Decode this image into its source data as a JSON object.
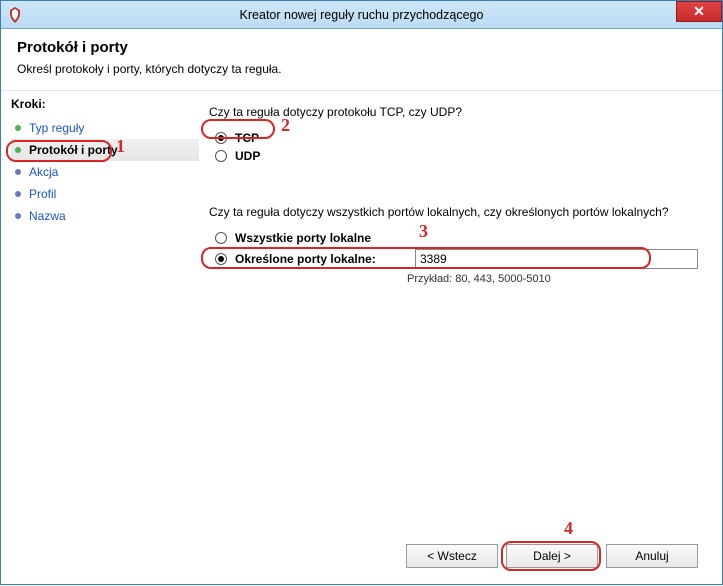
{
  "window": {
    "title": "Kreator nowej reguły ruchu przychodzącego",
    "close_glyph": "✕"
  },
  "header": {
    "title": "Protokół i porty",
    "subtitle": "Określ protokoły i porty, których dotyczy ta reguła."
  },
  "sidebar": {
    "label": "Kroki:",
    "items": [
      {
        "label": "Typ reguły"
      },
      {
        "label": "Protokół i porty"
      },
      {
        "label": "Akcja"
      },
      {
        "label": "Profil"
      },
      {
        "label": "Nazwa"
      }
    ]
  },
  "main": {
    "question_protocol": "Czy ta reguła dotyczy protokołu TCP, czy UDP?",
    "option_tcp": "TCP",
    "option_udp": "UDP",
    "question_ports": "Czy ta reguła dotyczy wszystkich portów lokalnych, czy określonych portów lokalnych?",
    "option_all_ports": "Wszystkie porty lokalne",
    "option_specific_ports": "Określone porty lokalne:",
    "port_value": "3389",
    "hint": "Przykład: 80, 443, 5000-5010"
  },
  "buttons": {
    "back": "< Wstecz",
    "next": "Dalej >",
    "cancel": "Anuluj"
  },
  "annotations": {
    "n1": "1",
    "n2": "2",
    "n3": "3",
    "n4": "4"
  }
}
